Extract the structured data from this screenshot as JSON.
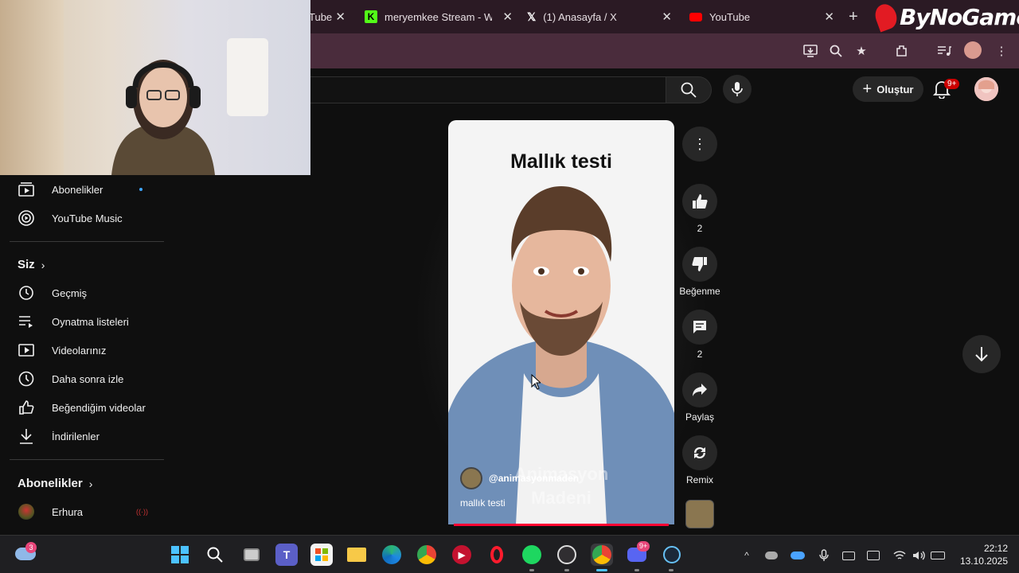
{
  "browser": {
    "tabs": [
      {
        "title": "Tube",
        "icon": "youtube-icon"
      },
      {
        "title": "meryemkee Stream - Wa",
        "icon": "kick-icon"
      },
      {
        "title": "(1) Anasayfa / X",
        "icon": "x-icon"
      },
      {
        "title": "YouTube",
        "icon": "youtube-icon"
      }
    ],
    "new_tab_label": "+",
    "overlay_logo": "ByNoGame"
  },
  "youtube": {
    "create_label": "Oluştur",
    "notifications_badge": "9+"
  },
  "sidebar": {
    "top_items": [
      {
        "label": "Abonelikler",
        "icon": "subscriptions-icon"
      },
      {
        "label": "YouTube Music",
        "icon": "youtube-music-icon"
      }
    ],
    "you_header": "Siz",
    "you_items": [
      {
        "label": "Geçmiş",
        "icon": "history-icon"
      },
      {
        "label": "Oynatma listeleri",
        "icon": "playlists-icon"
      },
      {
        "label": "Videolarınız",
        "icon": "your-videos-icon"
      },
      {
        "label": "Daha sonra izle",
        "icon": "watch-later-icon"
      },
      {
        "label": "Beğendiğim videolar",
        "icon": "liked-videos-icon"
      },
      {
        "label": "İndirilenler",
        "icon": "downloads-icon"
      }
    ],
    "subs_header": "Abonelikler",
    "subs_items": [
      {
        "label": "Erhura",
        "icon": "channel-avatar-icon"
      }
    ]
  },
  "short": {
    "title": "Mallık testi",
    "channel": "@animasyonmaden",
    "description": "mallık testi",
    "watermark": "Animasyon Madeni"
  },
  "actions": {
    "like_count": "2",
    "dislike_label": "Beğenme",
    "comment_count": "2",
    "share_label": "Paylaş",
    "remix_label": "Remix"
  },
  "taskbar": {
    "weather_badge": "3",
    "discord_badge": "9+",
    "time": "22:12",
    "date": "13.10.2025"
  }
}
